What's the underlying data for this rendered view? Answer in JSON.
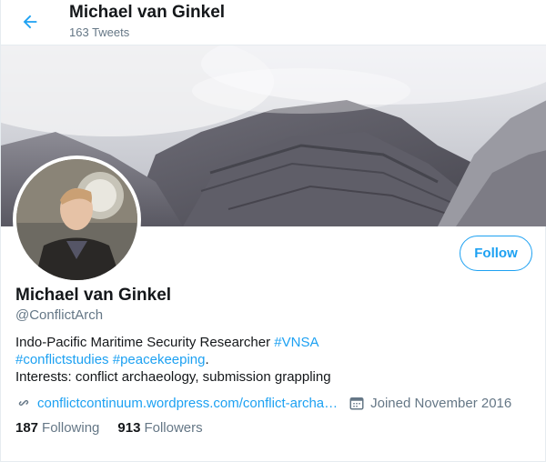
{
  "header": {
    "name": "Michael van Ginkel",
    "tweet_count": "163 Tweets"
  },
  "profile": {
    "name": "Michael van Ginkel",
    "handle": "@ConflictArch",
    "follow_label": "Follow",
    "bio": {
      "line1_text": "Indo-Pacific Maritime Security Researcher ",
      "line1_tag": "#VNSA",
      "line2_tag1": "#conflictstudies",
      "line2_tag2": "#peacekeeping",
      "line2_tail": ".",
      "line3": "Interests: conflict archaeology, submission grappling"
    },
    "website": "conflictcontinuum.wordpress.com/conflict-archa…",
    "joined": "Joined November 2016",
    "following_count": "187",
    "following_label": "Following",
    "followers_count": "913",
    "followers_label": "Followers"
  },
  "colors": {
    "accent": "#1da1f2",
    "muted": "#657786",
    "text": "#14171a"
  },
  "icons": {
    "back": "arrow-left-icon",
    "link": "link-icon",
    "calendar": "calendar-icon"
  }
}
